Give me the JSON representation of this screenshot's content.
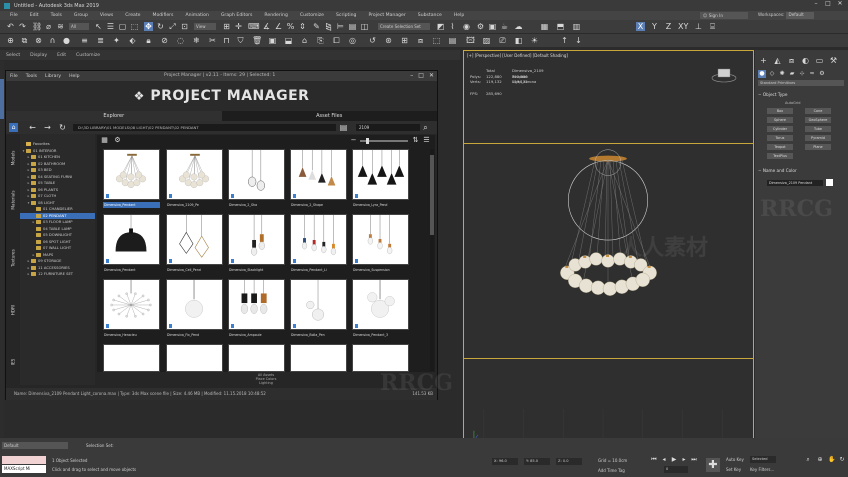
{
  "app": {
    "title": "Untitled - Autodesk 3ds Max 2019",
    "menu": [
      "File",
      "Edit",
      "Tools",
      "Group",
      "Views",
      "Create",
      "Modifiers",
      "Animation",
      "Graph Editors",
      "Rendering",
      "Customize",
      "Scripting",
      "Project Manager",
      "Substance",
      "Help"
    ],
    "signin": "Sign In",
    "workspace_label": "Workspaces:",
    "workspace_value": "Default",
    "toolbar_selection_set": "Create Selection Set",
    "toolbar_view": "View",
    "toolbar_all": "All"
  },
  "ribbon": [
    "Select",
    "Display",
    "Edit",
    "Customize"
  ],
  "project_manager": {
    "menu": [
      "File",
      "Tools",
      "Library",
      "Help"
    ],
    "title": "Project Manager | v2.11 - Items: 29 | Selected: 1",
    "brand": "PROJECT MANAGER",
    "tabs": [
      "Explorer",
      "Asset Files"
    ],
    "path": "D:\\3D LIBRARY\\01 MODELS\\08 LIGHT\\02 PENDANT\\02 PENDANT",
    "search": "2109",
    "vertical_tabs": [
      "Models",
      "Materials",
      "Textures",
      "HDRI",
      "IES"
    ],
    "tree": [
      {
        "label": "Favorites",
        "depth": 0,
        "arrow": ""
      },
      {
        "label": "01 INTERIOR",
        "depth": 0,
        "arrow": "▾"
      },
      {
        "label": "01 KITCHEN",
        "depth": 1,
        "arrow": "▸"
      },
      {
        "label": "02 BATHROOM",
        "depth": 1,
        "arrow": "▸"
      },
      {
        "label": "03 BED",
        "depth": 1,
        "arrow": "▸"
      },
      {
        "label": "04 SEATING FURNI",
        "depth": 1,
        "arrow": "▸"
      },
      {
        "label": "05 TABLE",
        "depth": 1,
        "arrow": "▸"
      },
      {
        "label": "06 PLANTS",
        "depth": 1,
        "arrow": "▸"
      },
      {
        "label": "07 CLOTH",
        "depth": 1,
        "arrow": "▸"
      },
      {
        "label": "08 LIGHT",
        "depth": 1,
        "arrow": "▾"
      },
      {
        "label": "01 CHANDELIER",
        "depth": 2,
        "arrow": ""
      },
      {
        "label": "02 PENDANT",
        "depth": 2,
        "arrow": "",
        "selected": true
      },
      {
        "label": "03 FLOOR LAMP",
        "depth": 2,
        "arrow": "▸"
      },
      {
        "label": "04 TABLE LAMP",
        "depth": 2,
        "arrow": ""
      },
      {
        "label": "05 DOWNLIGHT",
        "depth": 2,
        "arrow": ""
      },
      {
        "label": "06 SPOT LIGHT",
        "depth": 2,
        "arrow": ""
      },
      {
        "label": "07 WALL LIGHT",
        "depth": 2,
        "arrow": ""
      },
      {
        "label": "MAPS",
        "depth": 2,
        "arrow": "▸"
      },
      {
        "label": "09 STORAGE",
        "depth": 1,
        "arrow": "▸"
      },
      {
        "label": "11 ACCESSORIES",
        "depth": 1,
        "arrow": "▸"
      },
      {
        "label": "12 FURNITURE SET",
        "depth": 1,
        "arrow": "▸"
      }
    ],
    "thumbnails": [
      {
        "caption": "Dimensiva_Pendant",
        "style": "globes",
        "selected": true
      },
      {
        "caption": "Dimensiva_2109_Pe",
        "style": "globes"
      },
      {
        "caption": "Dimensiva_2_Sha",
        "style": "drops"
      },
      {
        "caption": "Dimensiva_2_Shape",
        "style": "cones"
      },
      {
        "caption": "Dimensiva_Lyra_Pend",
        "style": "blackcones"
      },
      {
        "caption": "Dimensiva_Pendant",
        "style": "dome"
      },
      {
        "caption": "Dimensiva_Cell_Pend",
        "style": "cages"
      },
      {
        "caption": "Dimensiva_Stacklight",
        "style": "bulbs"
      },
      {
        "caption": "Dimensiva_Pendant_Li",
        "style": "colorbulbs"
      },
      {
        "caption": "Dimensiva_Suspension",
        "style": "hangbulbs"
      },
      {
        "caption": "Dimensiva_Heracleu",
        "style": "branch"
      },
      {
        "caption": "Dimensiva_Fix_Pend",
        "style": "balls"
      },
      {
        "caption": "Dimensiva_Ampoule",
        "style": "blackbulbs"
      },
      {
        "caption": "Dimensiva_Bolla_Pen",
        "style": "stacked"
      },
      {
        "caption": "Dimensiva_Pendant_3",
        "style": "balls2"
      }
    ],
    "lower_panels": [
      "All Assets",
      "Place Colors",
      "Lighting"
    ],
    "status": "Name: Dimensiva_2109 Pendant Light_corona.max | Type: 3ds Max scene file | Size: 4.46 MB | Modified: 11.15.2018 10:48:52",
    "status_size": "141.53 KB"
  },
  "viewport": {
    "label": "[+] [Perspective] [User Defined] [Default Shading]",
    "stats_head": [
      "",
      "Total",
      "Dimensiva_2109 Pendant Light_corona"
    ],
    "stats_polys": [
      "Polys:",
      "122,880",
      "122,880"
    ],
    "stats_verts": [
      "Verts:",
      "119,132",
      "119,132"
    ],
    "fps_label": "FPS:",
    "fps_value": "285,690"
  },
  "command_panel": {
    "dropdown": "Standard Primitives",
    "object_type_title": "Object Type",
    "autogrid": "AutoGrid",
    "object_buttons": [
      "Box",
      "Cone",
      "Sphere",
      "GeoSphere",
      "Cylinder",
      "Tube",
      "Torus",
      "Pyramid",
      "Teapot",
      "Plane",
      "TextPlus"
    ],
    "name_color_title": "Name and Color",
    "name_value": "Dimensiva_2109 Pendant"
  },
  "statusbar": {
    "layer": "Default",
    "selection_info": "1 Object Selected",
    "prompt": "Click and drag to select and move objects",
    "script": "MAXScript Mi",
    "x": "X: 96.0",
    "y": "Y: 85.0",
    "z": "Z: 0.0",
    "grid": "Grid = 10.0cm",
    "add_time_tag": "Add Time Tag",
    "autokey": "Auto Key",
    "selected": "Selected",
    "set_key": "Set Key",
    "key_filters": "Key Filters...",
    "frame": "0",
    "selection_set_label": "Selection Set:"
  },
  "colors": {
    "accent": "#3a6fb8",
    "viewport_border": "#c8a83a",
    "folder": "#c8a544"
  },
  "watermark": {
    "text": "RRCG",
    "text2": "人人素材"
  }
}
